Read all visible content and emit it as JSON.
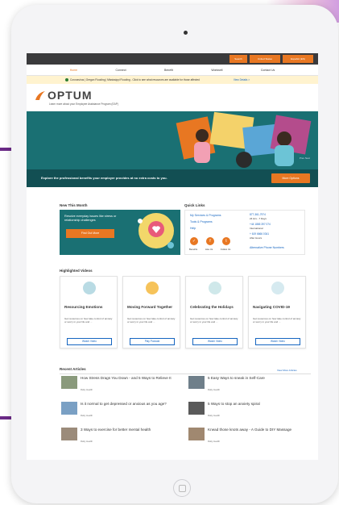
{
  "topbar": {
    "buttons": [
      "Search",
      "United States",
      "Español (ES)"
    ]
  },
  "nav": {
    "items": [
      "Home",
      "Connect",
      "Benefit",
      "Workwell",
      "Contact Us"
    ],
    "active": "Home"
  },
  "alert": {
    "text": "Coronavirus | Oregon Flooding | Mississippi Flooding - Click to see what resources are available for those affected",
    "link": "View Details >"
  },
  "brand": {
    "name": "OPTUM",
    "tagline": "Learn more about your Employee Assistance Program (EAP)"
  },
  "hero": {
    "banner_text": "Explore the professional benefits your employer provides at no extra costs to you.",
    "banner_button": "More Options",
    "pager": "Prev Next"
  },
  "new_this_month": {
    "title": "New This Month",
    "text": "Resolve everyday issues like stress or relationship challenges",
    "button": "Find Out More"
  },
  "quick_links": {
    "title": "Quick Links",
    "links": [
      "My Services & Programs",
      "Tools & Programs",
      "Help"
    ],
    "phones": [
      {
        "number": "877-361-7974",
        "sub": "24 Hrs - 7 Days"
      },
      {
        "number": "+44 1865 397 074",
        "sub": "International"
      },
      {
        "number": "+ 619 6666 0341",
        "sub": "After Hours"
      }
    ],
    "alt_link": "Alternative Phone Numbers",
    "icons": [
      "Benefits",
      "Like Us",
      "Follow Us"
    ]
  },
  "highlighted_videos": {
    "title": "Highlighted Videos",
    "cards": [
      {
        "title": "Resourcing Emotions",
        "desc": "Get resources on how take control of anxiety or worry in your life and ...",
        "button": "Watch Video",
        "color": "#b9dbe4"
      },
      {
        "title": "Moving Forward Together",
        "desc": "Get resources on how take control of anxiety or worry in your life and ...",
        "button": "Play Podcast",
        "color": "#f6c35a"
      },
      {
        "title": "Celebrating the Holidays",
        "desc": "Get resources on how take control of anxiety or worry in your life and ...",
        "button": "Watch Video",
        "color": "#cfe8ea"
      },
      {
        "title": "Navigating COVID-19",
        "desc": "Get resources on how take control of anxiety or worry in your life and ...",
        "button": "Watch Video",
        "color": "#d6eaf0"
      }
    ]
  },
  "recent_articles": {
    "title": "Recent Articles",
    "more": "View More Articles",
    "items": [
      {
        "title": "How Stress Drags You Down - and 5 Ways to Relieve It",
        "source": "Rally Health"
      },
      {
        "title": "5 Easy Ways to sneak in Self-Care",
        "source": "Rally Health"
      },
      {
        "title": "Is it normal to get depressed or anxious as you age?",
        "source": "Rally Health"
      },
      {
        "title": "5 Ways to stop an anxiety spiral",
        "source": "Rally Health"
      },
      {
        "title": "3 Ways to exercise for better mental health",
        "source": "Rally Health"
      },
      {
        "title": "Knead those knots away - A Guide to DIY Massage",
        "source": "Rally Health"
      }
    ]
  },
  "colors": {
    "accent": "#e87722",
    "teal": "#1a7073",
    "link": "#1565c0"
  }
}
